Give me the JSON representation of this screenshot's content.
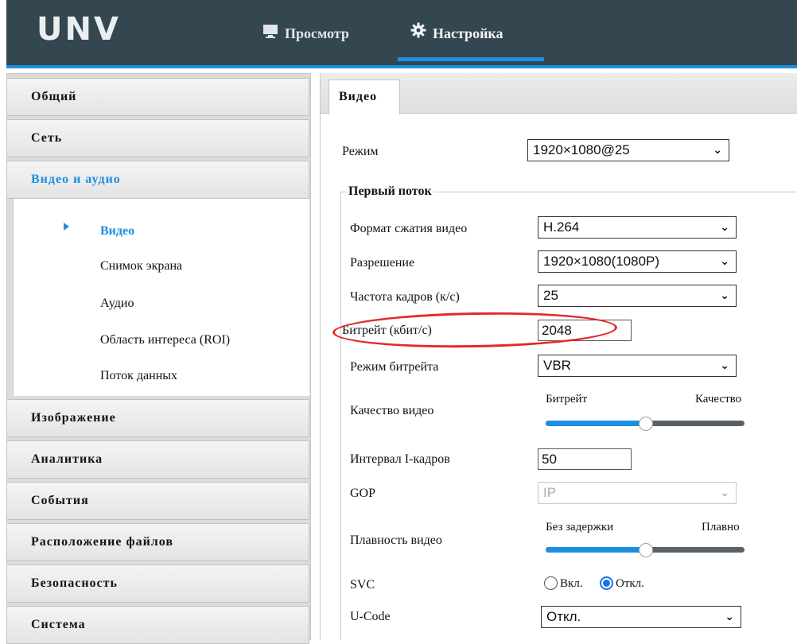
{
  "header": {
    "logo": "UNV",
    "tabs": [
      {
        "label": "Просмотр",
        "icon": "monitor-icon"
      },
      {
        "label": "Настройка",
        "icon": "gear-icon"
      }
    ],
    "accent": "#1d8fe1",
    "bg": "#34464f"
  },
  "sidebar": {
    "items": [
      {
        "label": "Общий"
      },
      {
        "label": "Сеть"
      },
      {
        "label": "Видео и аудио"
      },
      {
        "label": "Изображение"
      },
      {
        "label": "Аналитика"
      },
      {
        "label": "События"
      },
      {
        "label": "Расположение файлов"
      },
      {
        "label": "Безопасность"
      },
      {
        "label": "Система"
      }
    ],
    "submenu": [
      {
        "label": "Видео"
      },
      {
        "label": "Снимок экрана"
      },
      {
        "label": "Аудио"
      },
      {
        "label": "Область интереса (ROI)"
      },
      {
        "label": "Поток данных"
      }
    ]
  },
  "content": {
    "tab": "Видео",
    "mode": {
      "label": "Режим",
      "value": "1920×1080@25"
    },
    "stream_legend": "Первый поток",
    "fields": {
      "codec": {
        "label": "Формат сжатия видео",
        "value": "H.264"
      },
      "resolution": {
        "label": "Разрешение",
        "value": "1920×1080(1080P)"
      },
      "framerate": {
        "label": "Частота кадров (к/с)",
        "value": "25"
      },
      "bitrate": {
        "label": "Битрейт (кбит/с)",
        "value": "2048"
      },
      "bitrate_mode": {
        "label": "Режим битрейта",
        "value": "VBR"
      },
      "quality": {
        "label": "Качество видео",
        "left": "Битрейт",
        "right": "Качество",
        "level": 0.53
      },
      "iframe": {
        "label": "Интервал I-кадров",
        "value": "50"
      },
      "gop": {
        "label": "GOP",
        "value": "IP"
      },
      "smooth": {
        "label": "Плавность видео",
        "left": "Без задержки",
        "right": "Плавно",
        "level": 0.53
      },
      "svc": {
        "label": "SVC",
        "on": "Вкл.",
        "off": "Откл.",
        "selected": "off"
      },
      "ucode": {
        "label": "U-Code",
        "value": "Откл."
      }
    }
  }
}
